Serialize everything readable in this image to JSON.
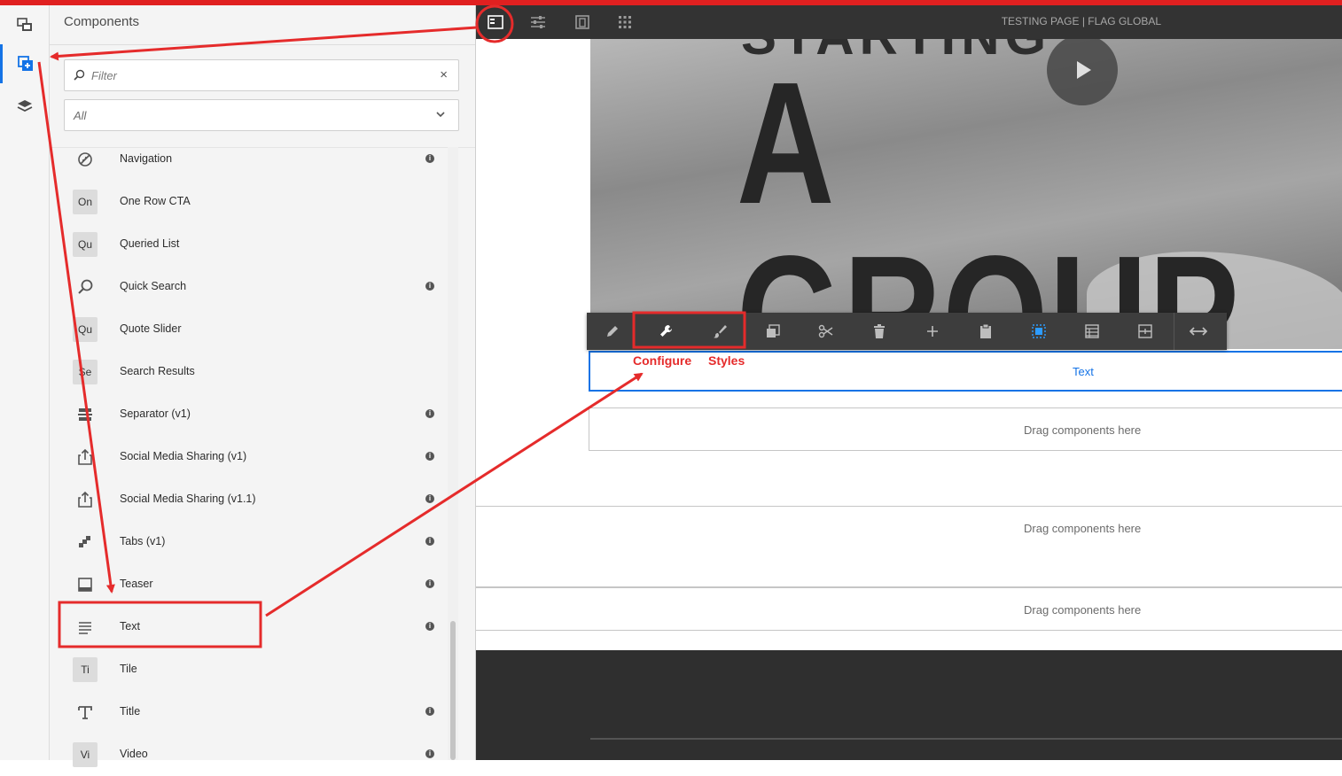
{
  "panel": {
    "title": "Components",
    "filter_placeholder": "Filter",
    "clear_glyph": "×",
    "group_select": "All"
  },
  "components": [
    {
      "label": "Navigation",
      "icon": "navigation-icon",
      "abbr": "",
      "info": true
    },
    {
      "label": "One Row CTA",
      "icon": "",
      "abbr": "On",
      "info": false
    },
    {
      "label": "Queried List",
      "icon": "",
      "abbr": "Qu",
      "info": false
    },
    {
      "label": "Quick Search",
      "icon": "search-icon",
      "abbr": "",
      "info": true
    },
    {
      "label": "Quote Slider",
      "icon": "",
      "abbr": "Qu",
      "info": false
    },
    {
      "label": "Search Results",
      "icon": "",
      "abbr": "Se",
      "info": false
    },
    {
      "label": "Separator (v1)",
      "icon": "separator-icon",
      "abbr": "",
      "info": true
    },
    {
      "label": "Social Media Sharing (v1)",
      "icon": "share-icon",
      "abbr": "",
      "info": true
    },
    {
      "label": "Social Media Sharing (v1.1)",
      "icon": "share-icon",
      "abbr": "",
      "info": true
    },
    {
      "label": "Tabs (v1)",
      "icon": "tabs-icon",
      "abbr": "",
      "info": true
    },
    {
      "label": "Teaser",
      "icon": "teaser-icon",
      "abbr": "",
      "info": true
    },
    {
      "label": "Text",
      "icon": "text-align-icon",
      "abbr": "",
      "info": true
    },
    {
      "label": "Tile",
      "icon": "",
      "abbr": "Ti",
      "info": false
    },
    {
      "label": "Title",
      "icon": "title-icon",
      "abbr": "",
      "info": true
    },
    {
      "label": "Video",
      "icon": "",
      "abbr": "Vi",
      "info": true
    }
  ],
  "toolbar": {
    "page_title": "TESTING PAGE | FLAG GLOBAL"
  },
  "hero": {
    "top_text": "STARTING",
    "big_text": "A GROUP"
  },
  "page": {
    "text_component_label": "Text",
    "drop_label": "Drag components here"
  },
  "annotations": {
    "configure": "Configure",
    "styles": "Styles",
    "color": "#e52b2b"
  },
  "colors": {
    "accent": "#1473e6",
    "toolbar_bg": "#333333",
    "annotation": "#e52b2b"
  }
}
